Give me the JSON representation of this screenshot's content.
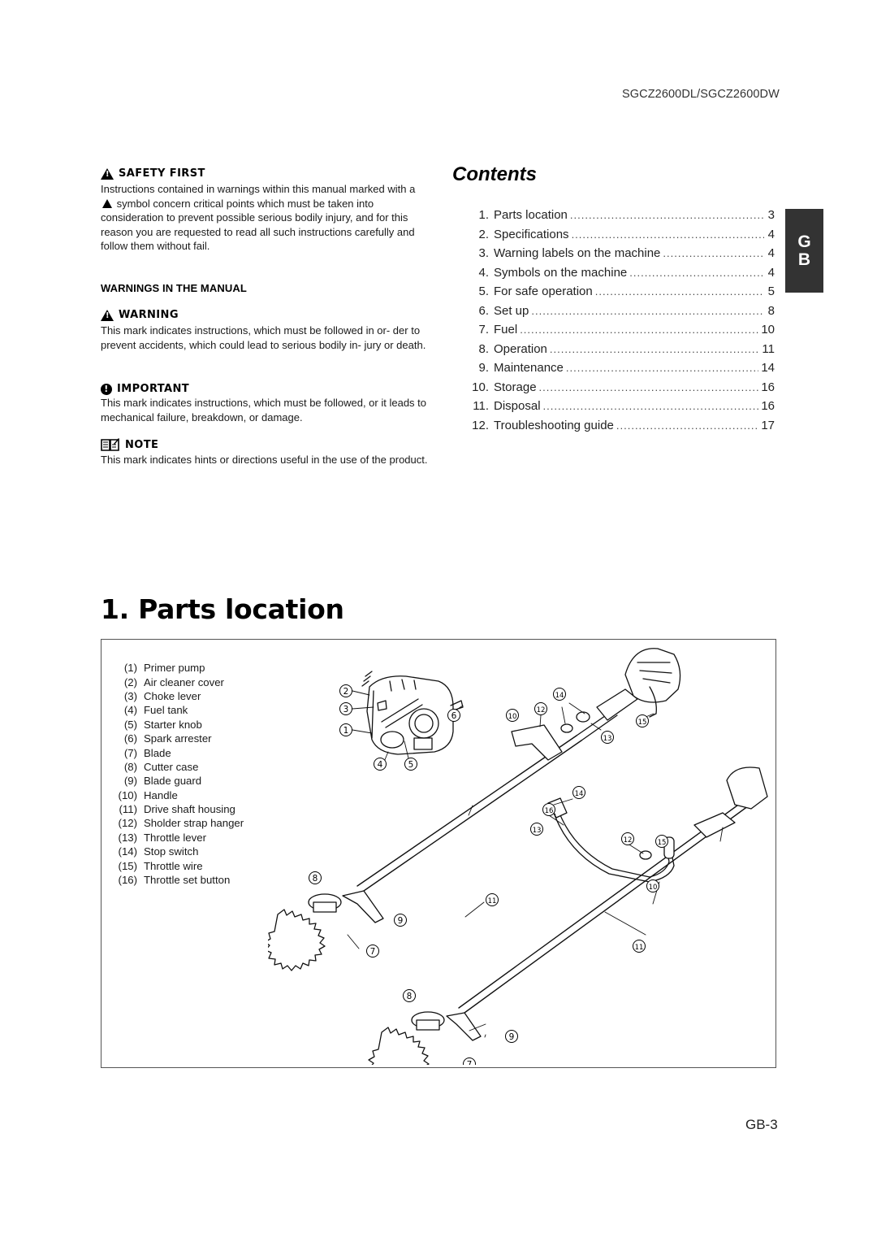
{
  "header": {
    "model": "SGCZ2600DL/SGCZ2600DW"
  },
  "safety_first": {
    "title": "SAFETY FIRST",
    "body_part1": "Instructions contained in warnings within this manual marked",
    "body_part2_prefix": "with a",
    "body_part2_suffix": "symbol concern critical points which must be taken",
    "body_part3": "into consideration to prevent possible serious bodily injury, and for this reason you are requested to read all such instructions carefully and follow them without fail."
  },
  "warnings_section": {
    "title": "WARNINGS IN THE MANUAL",
    "warning": {
      "title": "WARNING",
      "icon": "warning-triangle-icon",
      "body": "This mark indicates instructions, which must be followed in or- der to prevent accidents, which could lead to serious bodily in- jury or death."
    },
    "important": {
      "title": "IMPORTANT",
      "icon": "exclamation-circle-icon",
      "body": "This mark indicates instructions, which must be followed, or it leads to mechanical failure, breakdown, or damage."
    },
    "note": {
      "title": "NOTE",
      "icon": "book-note-icon",
      "body": "This mark indicates hints or directions useful in the use of the product."
    }
  },
  "contents": {
    "title": "Contents",
    "items": [
      {
        "num": "1.",
        "label": "Parts location",
        "page": "3"
      },
      {
        "num": "2.",
        "label": "Specifications",
        "page": "4"
      },
      {
        "num": "3.",
        "label": "Warning labels on the machine",
        "page": "4"
      },
      {
        "num": "4.",
        "label": "Symbols on the machine",
        "page": "4"
      },
      {
        "num": "5.",
        "label": "For safe operation",
        "page": "5"
      },
      {
        "num": "6.",
        "label": "Set up",
        "page": "8"
      },
      {
        "num": "7.",
        "label": "Fuel",
        "page": "10"
      },
      {
        "num": "8.",
        "label": "Operation",
        "page": "11"
      },
      {
        "num": "9.",
        "label": "Maintenance",
        "page": "14"
      },
      {
        "num": "10.",
        "label": "Storage",
        "page": "16"
      },
      {
        "num": "11.",
        "label": "Disposal",
        "page": "16"
      },
      {
        "num": "12.",
        "label": "Troubleshooting guide",
        "page": "17"
      }
    ]
  },
  "language_tab": {
    "line1": "G",
    "line2": "B"
  },
  "parts_location": {
    "title": "1. Parts location",
    "parts": [
      {
        "num": "(1)",
        "label": "Primer pump"
      },
      {
        "num": "(2)",
        "label": "Air cleaner cover"
      },
      {
        "num": "(3)",
        "label": "Choke lever"
      },
      {
        "num": "(4)",
        "label": "Fuel tank"
      },
      {
        "num": "(5)",
        "label": "Starter knob"
      },
      {
        "num": "(6)",
        "label": "Spark arrester"
      },
      {
        "num": "(7)",
        "label": "Blade"
      },
      {
        "num": "(8)",
        "label": "Cutter case"
      },
      {
        "num": "(9)",
        "label": "Blade guard"
      },
      {
        "num": "(10)",
        "label": "Handle"
      },
      {
        "num": "(11)",
        "label": "Drive shaft housing"
      },
      {
        "num": "(12)",
        "label": "Sholder strap hanger"
      },
      {
        "num": "(13)",
        "label": "Throttle lever"
      },
      {
        "num": "(14)",
        "label": "Stop switch"
      },
      {
        "num": "(15)",
        "label": "Throttle wire"
      },
      {
        "num": "(16)",
        "label": "Throttle set button"
      }
    ],
    "callouts": {
      "engine": [
        "2",
        "3",
        "1",
        "6",
        "4",
        "5"
      ],
      "loop_handle": [
        "14",
        "12",
        "10",
        "15",
        "13",
        "11",
        "8",
        "9",
        "7"
      ],
      "bike_handle": [
        "14",
        "16",
        "13",
        "12",
        "15",
        "10",
        "11",
        "8",
        "9",
        "7"
      ]
    }
  },
  "footer": {
    "page": "GB-3"
  }
}
